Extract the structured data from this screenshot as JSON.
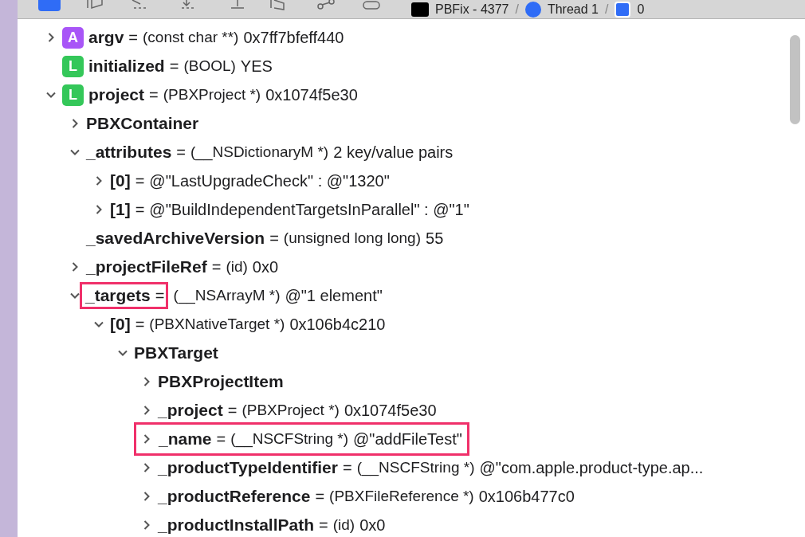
{
  "toolbar": {
    "project": "PBFix - 4377",
    "separators": [
      "/",
      "/"
    ],
    "thread": "Thread 1",
    "frame": "0"
  },
  "variables": [
    {
      "name": "argv",
      "badge": "A",
      "equals": "=",
      "type": "(const char **)",
      "value": "0x7ff7bfeff440",
      "expanded": false
    },
    {
      "name": "initialized",
      "badge": "L",
      "equals": "=",
      "type": "(BOOL)",
      "value": "YES"
    },
    {
      "name": "project",
      "badge": "L",
      "equals": "=",
      "type": "(PBXProject *)",
      "value": "0x1074f5e30",
      "expanded": true,
      "children": [
        {
          "name": "PBXContainer",
          "expanded": false
        },
        {
          "name": "_attributes",
          "equals": "=",
          "type": "(__NSDictionaryM *)",
          "value": "2 key/value pairs",
          "expanded": true,
          "children": [
            {
              "name": "[0]",
              "equals": "=",
              "value": "@\"LastUpgradeCheck\" : @\"1320\"",
              "expanded": false
            },
            {
              "name": "[1]",
              "equals": "=",
              "value": "@\"BuildIndependentTargetsInParallel\" : @\"1\"",
              "expanded": false
            }
          ]
        },
        {
          "name": "_savedArchiveVersion",
          "equals": "=",
          "type": "(unsigned long long)",
          "value": "55"
        },
        {
          "name": "_projectFileRef",
          "equals": "=",
          "type": "(id)",
          "value": "0x0",
          "expanded": false
        },
        {
          "name": "_targets",
          "equals": "=",
          "type": "(__NSArrayM *)",
          "value": "@\"1 element\"",
          "expanded": true,
          "highlighted": true,
          "children": [
            {
              "name": "[0]",
              "equals": "=",
              "type": "(PBXNativeTarget *)",
              "value": "0x106b4c210",
              "expanded": true,
              "children": [
                {
                  "name": "PBXTarget",
                  "expanded": true,
                  "children": [
                    {
                      "name": "PBXProjectItem",
                      "expanded": false
                    },
                    {
                      "name": "_project",
                      "equals": "=",
                      "type": "(PBXProject *)",
                      "value": "0x1074f5e30",
                      "expanded": false
                    },
                    {
                      "name": "_name",
                      "equals": "=",
                      "type": "(__NSCFString *)",
                      "value": "@\"addFileTest\"",
                      "expanded": false,
                      "highlighted_whole_row": true
                    },
                    {
                      "name": "_productTypeIdentifier",
                      "equals": "=",
                      "type": "(__NSCFString *)",
                      "value": "@\"com.apple.product-type.ap...",
                      "expanded": false
                    },
                    {
                      "name": "_productReference",
                      "equals": "=",
                      "type": "(PBXFileReference *)",
                      "value": "0x106b477c0",
                      "expanded": false
                    },
                    {
                      "name": "_productInstallPath",
                      "equals": "=",
                      "type": "(id)",
                      "value": "0x0",
                      "expanded": false
                    }
                  ]
                }
              ]
            }
          ]
        }
      ]
    }
  ]
}
